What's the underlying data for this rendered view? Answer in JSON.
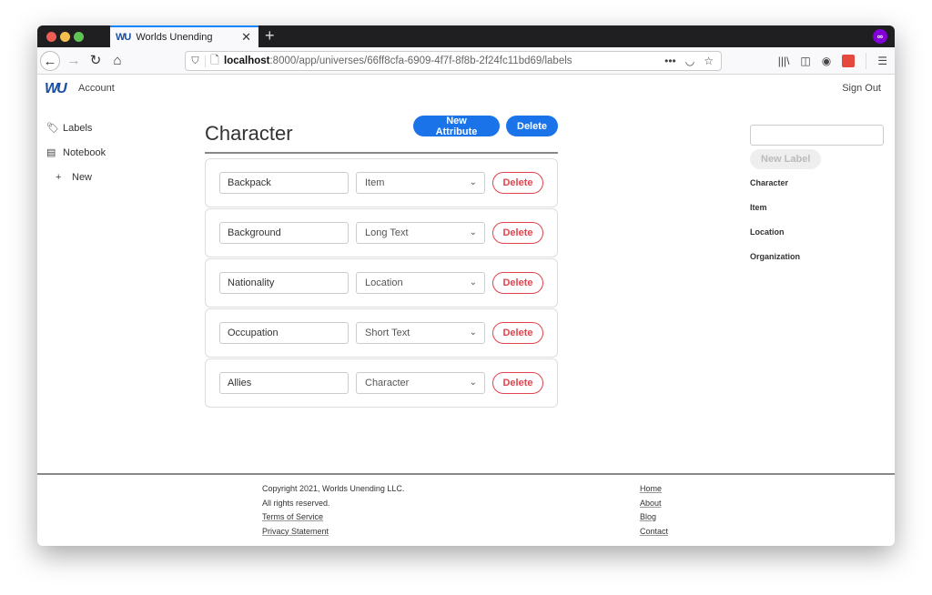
{
  "browser": {
    "tab_title": "Worlds Unending",
    "tab_logo": "WU",
    "url_host": "localhost",
    "url_rest": ":8000/app/universes/66ff8cfa-6909-4f7f-8f8b-2f24fc11bd69/labels"
  },
  "topnav": {
    "brand": "WU",
    "account": "Account",
    "signout": "Sign Out"
  },
  "sidebar": {
    "items": [
      {
        "label": "Labels",
        "icon": "tag-icon"
      },
      {
        "label": "Notebook",
        "icon": "notebook-icon"
      },
      {
        "label": "New",
        "icon": "plus-icon"
      }
    ]
  },
  "main": {
    "title": "Character",
    "new_attribute_label": "New Attribute",
    "delete_label": "Delete",
    "attributes": [
      {
        "name": "Backpack",
        "type": "Item",
        "delete": "Delete"
      },
      {
        "name": "Background",
        "type": "Long Text",
        "delete": "Delete"
      },
      {
        "name": "Nationality",
        "type": "Location",
        "delete": "Delete"
      },
      {
        "name": "Occupation",
        "type": "Short Text",
        "delete": "Delete"
      },
      {
        "name": "Allies",
        "type": "Character",
        "delete": "Delete"
      }
    ]
  },
  "rightpanel": {
    "new_label_placeholder": "",
    "new_label_button": "New Label",
    "labels": [
      "Character",
      "Item",
      "Location",
      "Organization"
    ]
  },
  "footer": {
    "copyright": "Copyright 2021, Worlds Unending LLC.",
    "rights": "All rights reserved.",
    "terms": "Terms of Service",
    "privacy": "Privacy Statement",
    "links": [
      "Home",
      "About",
      "Blog",
      "Contact"
    ]
  },
  "colors": {
    "primary": "#1a73e8",
    "danger": "#e0444e",
    "brand": "#1a4fa3"
  }
}
